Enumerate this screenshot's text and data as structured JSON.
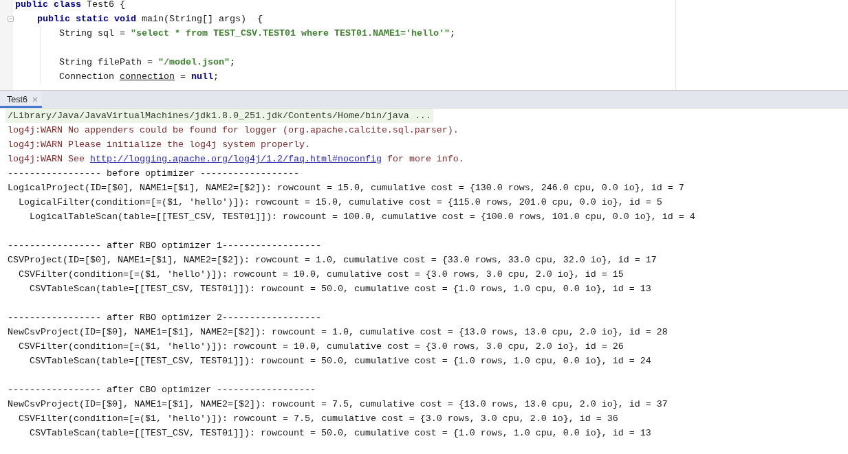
{
  "editor": {
    "lines": [
      {
        "kind": "code",
        "segments": [
          {
            "kind": "keyword",
            "text": "public class"
          },
          {
            "kind": "plain",
            "text": " Test6 {"
          }
        ],
        "children": [
          {
            "kind": "code",
            "expanded": true,
            "segments": [
              {
                "kind": "keyword",
                "text": "public static void"
              },
              {
                "kind": "plain",
                "text": " main(String[] args)  {"
              }
            ],
            "children": [
              {
                "kind": "code",
                "segments": [
                  {
                    "kind": "plain",
                    "text": "String sql = "
                  },
                  {
                    "kind": "string",
                    "text": "\"select * from TEST_CSV.TEST01 where TEST01.NAME1='hello'\""
                  },
                  {
                    "kind": "plain",
                    "text": ";"
                  }
                ]
              },
              {
                "kind": "blank"
              },
              {
                "kind": "code",
                "segments": [
                  {
                    "kind": "plain",
                    "text": "String filePath = "
                  },
                  {
                    "kind": "string",
                    "text": "\"/model.json\""
                  },
                  {
                    "kind": "plain",
                    "text": ";"
                  }
                ]
              },
              {
                "kind": "code",
                "segments": [
                  {
                    "kind": "plain",
                    "text": "Connection "
                  },
                  {
                    "kind": "variable",
                    "text": "connection"
                  },
                  {
                    "kind": "plain",
                    "text": " = "
                  },
                  {
                    "kind": "keyword",
                    "text": "null"
                  },
                  {
                    "kind": "plain",
                    "text": ";"
                  }
                ]
              }
            ]
          }
        ]
      }
    ]
  },
  "console": {
    "tabs": [
      {
        "label": "Test6",
        "selected": true
      }
    ],
    "log": [
      {
        "kind": "command",
        "segments": [
          {
            "kind": "plain",
            "text": "/Library/Java/JavaVirtualMachines/jdk1.8.0_251.jdk/Contents/Home/bin/java ..."
          }
        ]
      },
      {
        "kind": "warning",
        "segments": [
          {
            "kind": "plain",
            "text": "log4j:WARN No appenders could be found for logger (org.apache.calcite.sql.parser)."
          }
        ]
      },
      {
        "kind": "warning",
        "segments": [
          {
            "kind": "plain",
            "text": "log4j:WARN Please initialize the log4j system properly."
          }
        ]
      },
      {
        "kind": "warning",
        "segments": [
          {
            "kind": "plain",
            "text": "log4j:WARN See "
          },
          {
            "kind": "link",
            "text": "http://logging.apache.org/log4j/1.2/faq.html#noconfig"
          },
          {
            "kind": "plain",
            "text": " for more info."
          }
        ]
      }
    ],
    "sections": [
      {
        "header": "----------------- before optimizer ------------------",
        "plan": {
          "text": "LogicalProject(ID=[$0], NAME1=[$1], NAME2=[$2]): rowcount = 15.0, cumulative cost = {130.0 rows, 246.0 cpu, 0.0 io}, id = 7",
          "children": [
            {
              "text": "LogicalFilter(condition=[=($1, 'hello')]): rowcount = 15.0, cumulative cost = {115.0 rows, 201.0 cpu, 0.0 io}, id = 5",
              "children": [
                {
                  "text": "LogicalTableScan(table=[[TEST_CSV, TEST01]]): rowcount = 100.0, cumulative cost = {100.0 rows, 101.0 cpu, 0.0 io}, id = 4"
                }
              ]
            }
          ]
        }
      },
      {
        "header": "----------------- after RBO optimizer 1------------------",
        "plan": {
          "text": "CSVProject(ID=[$0], NAME1=[$1], NAME2=[$2]): rowcount = 1.0, cumulative cost = {33.0 rows, 33.0 cpu, 32.0 io}, id = 17",
          "children": [
            {
              "text": "CSVFilter(condition=[=($1, 'hello')]): rowcount = 10.0, cumulative cost = {3.0 rows, 3.0 cpu, 2.0 io}, id = 15",
              "children": [
                {
                  "text": "CSVTableScan(table=[[TEST_CSV, TEST01]]): rowcount = 50.0, cumulative cost = {1.0 rows, 1.0 cpu, 0.0 io}, id = 13"
                }
              ]
            }
          ]
        }
      },
      {
        "header": "----------------- after RBO optimizer 2------------------",
        "plan": {
          "text": "NewCsvProject(ID=[$0], NAME1=[$1], NAME2=[$2]): rowcount = 1.0, cumulative cost = {13.0 rows, 13.0 cpu, 2.0 io}, id = 28",
          "children": [
            {
              "text": "CSVFilter(condition=[=($1, 'hello')]): rowcount = 10.0, cumulative cost = {3.0 rows, 3.0 cpu, 2.0 io}, id = 26",
              "children": [
                {
                  "text": "CSVTableScan(table=[[TEST_CSV, TEST01]]): rowcount = 50.0, cumulative cost = {1.0 rows, 1.0 cpu, 0.0 io}, id = 24"
                }
              ]
            }
          ]
        }
      },
      {
        "header": "----------------- after CBO optimizer ------------------",
        "plan": {
          "text": "NewCsvProject(ID=[$0], NAME1=[$1], NAME2=[$2]): rowcount = 7.5, cumulative cost = {13.0 rows, 13.0 cpu, 2.0 io}, id = 37",
          "children": [
            {
              "text": "CSVFilter(condition=[=($1, 'hello')]): rowcount = 7.5, cumulative cost = {3.0 rows, 3.0 cpu, 2.0 io}, id = 36",
              "children": [
                {
                  "text": "CSVTableScan(table=[[TEST_CSV, TEST01]]): rowcount = 50.0, cumulative cost = {1.0 rows, 1.0 cpu, 0.0 io}, id = 13"
                }
              ]
            }
          ]
        }
      }
    ]
  }
}
